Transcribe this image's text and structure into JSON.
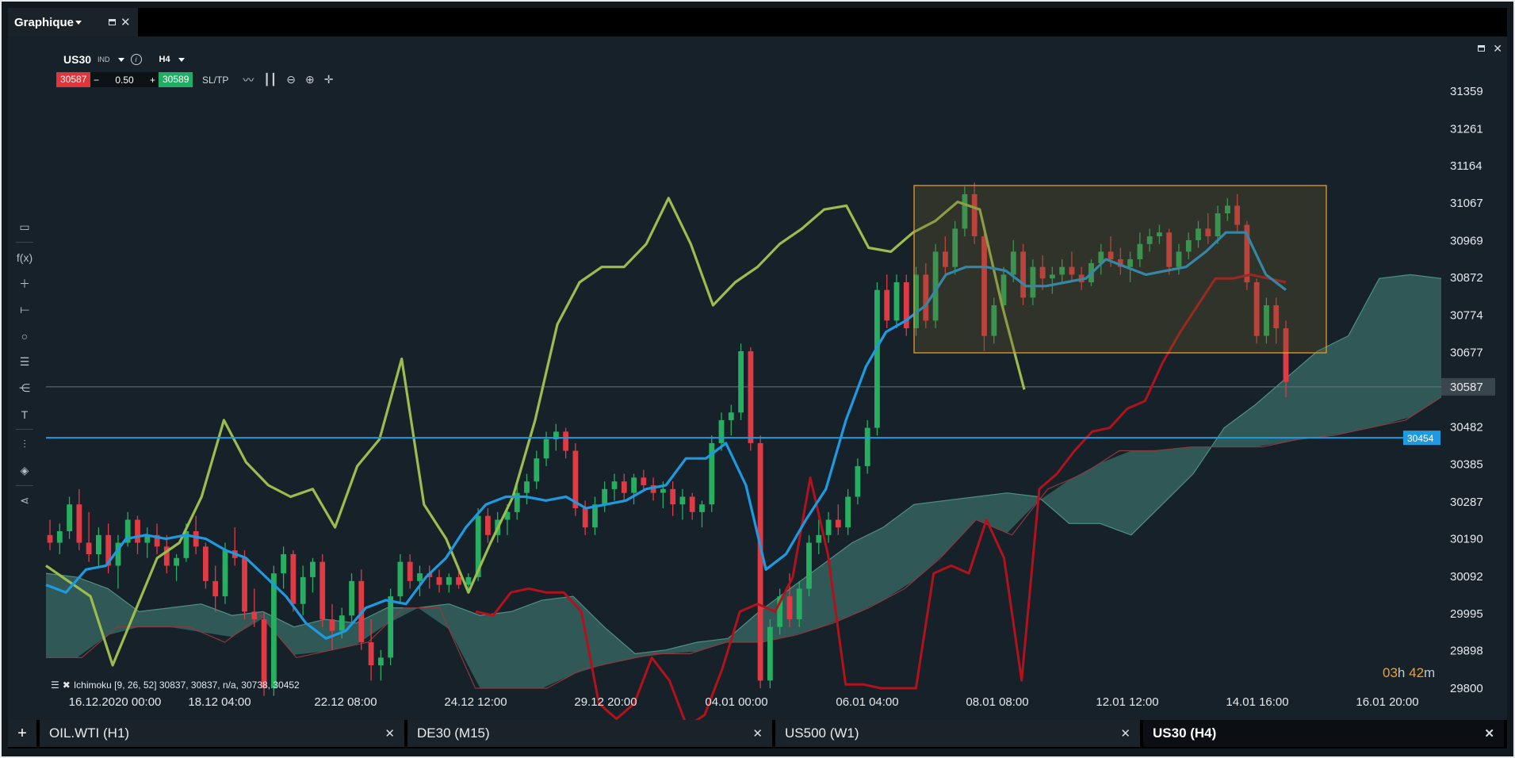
{
  "window": {
    "title": "Graphique"
  },
  "toolbar": {
    "symbol": "US30",
    "instrument_type": "IND",
    "timeframe": "H4",
    "sell_price": "30587",
    "quantity": "0.50",
    "buy_price": "30589",
    "minus": "−",
    "plus": "+",
    "sltp_label": "SL/TP"
  },
  "indicator": {
    "label": "Ichimoku [9, 26, 52] 30837, 30837, n/a, 30738, 30452"
  },
  "countdown": {
    "hours": "03",
    "h_unit": "h",
    "minutes": "42",
    "m_unit": "m"
  },
  "tabs": [
    {
      "label": "OIL.WTI (H1)",
      "active": false
    },
    {
      "label": "DE30 (M15)",
      "active": false
    },
    {
      "label": "US500 (W1)",
      "active": false
    },
    {
      "label": "US30 (H4)",
      "active": true
    }
  ],
  "colors": {
    "background": "#16212a",
    "bull": "#27ae60",
    "bear": "#e03a44",
    "tenkan": "#1e9be0",
    "kijun": "#b3121c",
    "chikou": "#9cbd4e",
    "cloud": "#3a6b65",
    "hline": "#1e9be0",
    "rect": "#e39a2e"
  },
  "chart_data": {
    "type": "candlestick",
    "symbol": "US30",
    "timeframe": "H4",
    "y_ticks": [
      31359,
      31261,
      31164,
      31067,
      30969,
      30872,
      30774,
      30677,
      30587,
      30482,
      30385,
      30287,
      30190,
      30092,
      29995,
      29898,
      29800
    ],
    "ylim": [
      29800,
      31359
    ],
    "x_ticks": [
      "16.12.2020 00:00",
      "18.12 04:00",
      "22.12 08:00",
      "24.12 12:00",
      "29.12 20:00",
      "04.01 00:00",
      "06.01 04:00",
      "08.01 08:00",
      "12.01 12:00",
      "14.01 16:00",
      "16.01 20:00"
    ],
    "current_price": 30587,
    "horizontal_line": 30454,
    "candles": [
      [
        30200,
        30240,
        30160,
        30180
      ],
      [
        30180,
        30230,
        30150,
        30210
      ],
      [
        30210,
        30300,
        30190,
        30280
      ],
      [
        30280,
        30320,
        30160,
        30180
      ],
      [
        30180,
        30260,
        30130,
        30150
      ],
      [
        30150,
        30220,
        30120,
        30200
      ],
      [
        30200,
        30230,
        30100,
        30120
      ],
      [
        30120,
        30200,
        30060,
        30180
      ],
      [
        30180,
        30260,
        30170,
        30240
      ],
      [
        30240,
        30250,
        30150,
        30180
      ],
      [
        30180,
        30220,
        30140,
        30200
      ],
      [
        30200,
        30230,
        30150,
        30170
      ],
      [
        30170,
        30200,
        30100,
        30120
      ],
      [
        30120,
        30150,
        30080,
        30140
      ],
      [
        30140,
        30230,
        30130,
        30210
      ],
      [
        30210,
        30250,
        30150,
        30170
      ],
      [
        30170,
        30180,
        30060,
        30080
      ],
      [
        30080,
        30120,
        30000,
        30040
      ],
      [
        30040,
        30180,
        30020,
        30160
      ],
      [
        30160,
        30220,
        30120,
        30140
      ],
      [
        30140,
        30160,
        29980,
        30000
      ],
      [
        30000,
        30060,
        29960,
        29980
      ],
      [
        29980,
        30000,
        29780,
        29800
      ],
      [
        29800,
        30120,
        29780,
        30100
      ],
      [
        30100,
        30170,
        30060,
        30150
      ],
      [
        30150,
        30160,
        30000,
        30020
      ],
      [
        30020,
        30120,
        29990,
        30090
      ],
      [
        30090,
        30140,
        30050,
        30130
      ],
      [
        30130,
        30150,
        29960,
        29980
      ],
      [
        29980,
        30020,
        29900,
        29950
      ],
      [
        29950,
        30010,
        29930,
        29990
      ],
      [
        29990,
        30100,
        29970,
        30080
      ],
      [
        30080,
        30110,
        29900,
        29920
      ],
      [
        29920,
        29980,
        29820,
        29860
      ],
      [
        29860,
        29900,
        29820,
        29880
      ],
      [
        29880,
        30060,
        29860,
        30040
      ],
      [
        30040,
        30150,
        30020,
        30130
      ],
      [
        30130,
        30150,
        30060,
        30080
      ],
      [
        30080,
        30120,
        30040,
        30100
      ],
      [
        30100,
        30120,
        30060,
        30090
      ],
      [
        30090,
        30110,
        30050,
        30070
      ],
      [
        30070,
        30100,
        30050,
        30090
      ],
      [
        30090,
        30120,
        30060,
        30070
      ],
      [
        30070,
        30100,
        30050,
        30090
      ],
      [
        30090,
        30270,
        30080,
        30250
      ],
      [
        30250,
        30270,
        30180,
        30200
      ],
      [
        30200,
        30260,
        30180,
        30240
      ],
      [
        30240,
        30280,
        30200,
        30260
      ],
      [
        30260,
        30330,
        30240,
        30310
      ],
      [
        30310,
        30360,
        30280,
        30340
      ],
      [
        30340,
        30420,
        30320,
        30400
      ],
      [
        30400,
        30470,
        30380,
        30450
      ],
      [
        30450,
        30490,
        30420,
        30470
      ],
      [
        30470,
        30480,
        30400,
        30420
      ],
      [
        30420,
        30440,
        30250,
        30270
      ],
      [
        30270,
        30290,
        30200,
        30220
      ],
      [
        30220,
        30300,
        30200,
        30280
      ],
      [
        30280,
        30340,
        30260,
        30320
      ],
      [
        30320,
        30360,
        30290,
        30340
      ],
      [
        30340,
        30360,
        30290,
        30310
      ],
      [
        30310,
        30360,
        30280,
        30350
      ],
      [
        30350,
        30370,
        30320,
        30330
      ],
      [
        30330,
        30350,
        30290,
        30310
      ],
      [
        30310,
        30340,
        30270,
        30320
      ],
      [
        30320,
        30340,
        30250,
        30280
      ],
      [
        30280,
        30320,
        30240,
        30300
      ],
      [
        30300,
        30310,
        30240,
        30260
      ],
      [
        30260,
        30290,
        30220,
        30280
      ],
      [
        30280,
        30460,
        30260,
        30440
      ],
      [
        30440,
        30520,
        30420,
        30500
      ],
      [
        30500,
        30540,
        30460,
        30520
      ],
      [
        30520,
        30700,
        30500,
        30680
      ],
      [
        30680,
        30690,
        30420,
        30440
      ],
      [
        30440,
        30460,
        29800,
        29820
      ],
      [
        29820,
        29980,
        29800,
        29960
      ],
      [
        29960,
        30060,
        29940,
        30040
      ],
      [
        30040,
        30100,
        29960,
        29980
      ],
      [
        29980,
        30080,
        29960,
        30060
      ],
      [
        30060,
        30200,
        30040,
        30180
      ],
      [
        30180,
        30240,
        30150,
        30200
      ],
      [
        30200,
        30260,
        30180,
        30240
      ],
      [
        30240,
        30280,
        30200,
        30220
      ],
      [
        30220,
        30320,
        30200,
        30300
      ],
      [
        30300,
        30400,
        30280,
        30380
      ],
      [
        30380,
        30500,
        30360,
        30480
      ],
      [
        30480,
        30860,
        30460,
        30840
      ],
      [
        30840,
        30880,
        30740,
        30760
      ],
      [
        30760,
        30880,
        30740,
        30860
      ],
      [
        30860,
        30880,
        30720,
        30740
      ],
      [
        30740,
        30900,
        30720,
        30880
      ],
      [
        30880,
        30910,
        30740,
        30760
      ],
      [
        30760,
        30960,
        30740,
        30940
      ],
      [
        30940,
        30980,
        30880,
        30900
      ],
      [
        30900,
        31020,
        30880,
        31000
      ],
      [
        31000,
        31110,
        30980,
        31090
      ],
      [
        31090,
        31120,
        30960,
        30980
      ],
      [
        30980,
        31000,
        30680,
        30720
      ],
      [
        30720,
        30820,
        30700,
        30800
      ],
      [
        30800,
        30900,
        30780,
        30880
      ],
      [
        30880,
        30970,
        30860,
        30940
      ],
      [
        30940,
        30960,
        30800,
        30820
      ],
      [
        30820,
        30920,
        30800,
        30900
      ],
      [
        30900,
        30930,
        30840,
        30870
      ],
      [
        30870,
        30900,
        30830,
        30880
      ],
      [
        30880,
        30920,
        30860,
        30900
      ],
      [
        30900,
        30940,
        30860,
        30880
      ],
      [
        30880,
        30900,
        30840,
        30860
      ],
      [
        30860,
        30920,
        30850,
        30910
      ],
      [
        30910,
        30960,
        30880,
        30940
      ],
      [
        30940,
        30980,
        30900,
        30920
      ],
      [
        30920,
        30950,
        30880,
        30900
      ],
      [
        30900,
        30940,
        30860,
        30920
      ],
      [
        30920,
        30990,
        30900,
        30960
      ],
      [
        30960,
        31000,
        30940,
        30980
      ],
      [
        30980,
        31010,
        30960,
        30990
      ],
      [
        30990,
        31000,
        30880,
        30900
      ],
      [
        30900,
        30960,
        30880,
        30940
      ],
      [
        30940,
        30990,
        30920,
        30970
      ],
      [
        30970,
        31020,
        30950,
        31000
      ],
      [
        31000,
        31040,
        30960,
        30980
      ],
      [
        30980,
        31060,
        30960,
        31040
      ],
      [
        31040,
        31080,
        31020,
        31060
      ],
      [
        31060,
        31090,
        30990,
        31010
      ],
      [
        31010,
        31020,
        30840,
        30860
      ],
      [
        30860,
        30870,
        30700,
        30720
      ],
      [
        30720,
        30820,
        30700,
        30800
      ],
      [
        30800,
        30820,
        30700,
        30740
      ],
      [
        30740,
        30760,
        30560,
        30600
      ]
    ],
    "tenkan": [
      30070,
      30050,
      30110,
      30120,
      30190,
      30200,
      30190,
      30200,
      30190,
      30160,
      30140,
      30090,
      30040,
      29970,
      29930,
      29950,
      30010,
      30030,
      30020,
      30090,
      30140,
      30220,
      30280,
      30300,
      30300,
      30290,
      30300,
      30270,
      30280,
      30290,
      30320,
      30330,
      30400,
      30400,
      30440,
      30330,
      30110,
      30150,
      30240,
      30320,
      30500,
      30640,
      30730,
      30760,
      30800,
      30880,
      30900,
      30900,
      30890,
      30850,
      30850,
      30860,
      30870,
      30920,
      30900,
      30880,
      30890,
      30900,
      30940,
      30990,
      30990,
      30880,
      30840
    ],
    "kijun": [
      30000,
      29990,
      30050,
      30060,
      30050,
      30050,
      30000,
      29760,
      29720,
      29760,
      29880,
      29820,
      29700,
      29730,
      29850,
      30000,
      30020,
      30000,
      30090,
      30350,
      30150,
      29810,
      29810,
      29800,
      29800,
      29800,
      30100,
      30120,
      30100,
      30240,
      30140,
      29820,
      30320,
      30360,
      30420,
      30470,
      30480,
      30530,
      30550,
      30650,
      30730,
      30800,
      30870,
      30870,
      30880,
      30870,
      30860
    ],
    "chikou": [
      30120,
      30080,
      30040,
      29860,
      30000,
      30140,
      30180,
      30300,
      30500,
      30390,
      30330,
      30300,
      30320,
      30220,
      30380,
      30450,
      30660,
      30280,
      30190,
      30050,
      30180,
      30300,
      30500,
      30750,
      30860,
      30900,
      30900,
      30960,
      31080,
      30960,
      30800,
      30860,
      30900,
      30960,
      31000,
      31050,
      31060,
      30950,
      30940,
      30990,
      31020,
      31070,
      31050,
      30800,
      30580
    ],
    "cloud_a": [
      30100,
      30090,
      30060,
      30000,
      30010,
      30020,
      29990,
      30000,
      29960,
      29980,
      29970,
      30010,
      30010,
      30020,
      29990,
      30000,
      30030,
      30040,
      29960,
      29890,
      29900,
      29920,
      29930,
      30000,
      30060,
      30120,
      30180,
      30220,
      30280,
      30290,
      30300,
      30310,
      30300,
      30230,
      30230,
      30200,
      30280,
      30360,
      30480,
      30540,
      30610,
      30680,
      30720,
      30870,
      30880,
      30870
    ],
    "cloud_b": [
      29880,
      29880,
      29960,
      29960,
      29960,
      29920,
      29990,
      29880,
      29900,
      29920,
      30010,
      30010,
      29800,
      29800,
      29800,
      29850,
      29870,
      29890,
      29890,
      29920,
      29920,
      29940,
      29970,
      30010,
      30060,
      30140,
      30240,
      30200,
      30320,
      30360,
      30420,
      30420,
      30430,
      30430,
      30430,
      30450,
      30460,
      30480,
      30500,
      30560
    ]
  }
}
